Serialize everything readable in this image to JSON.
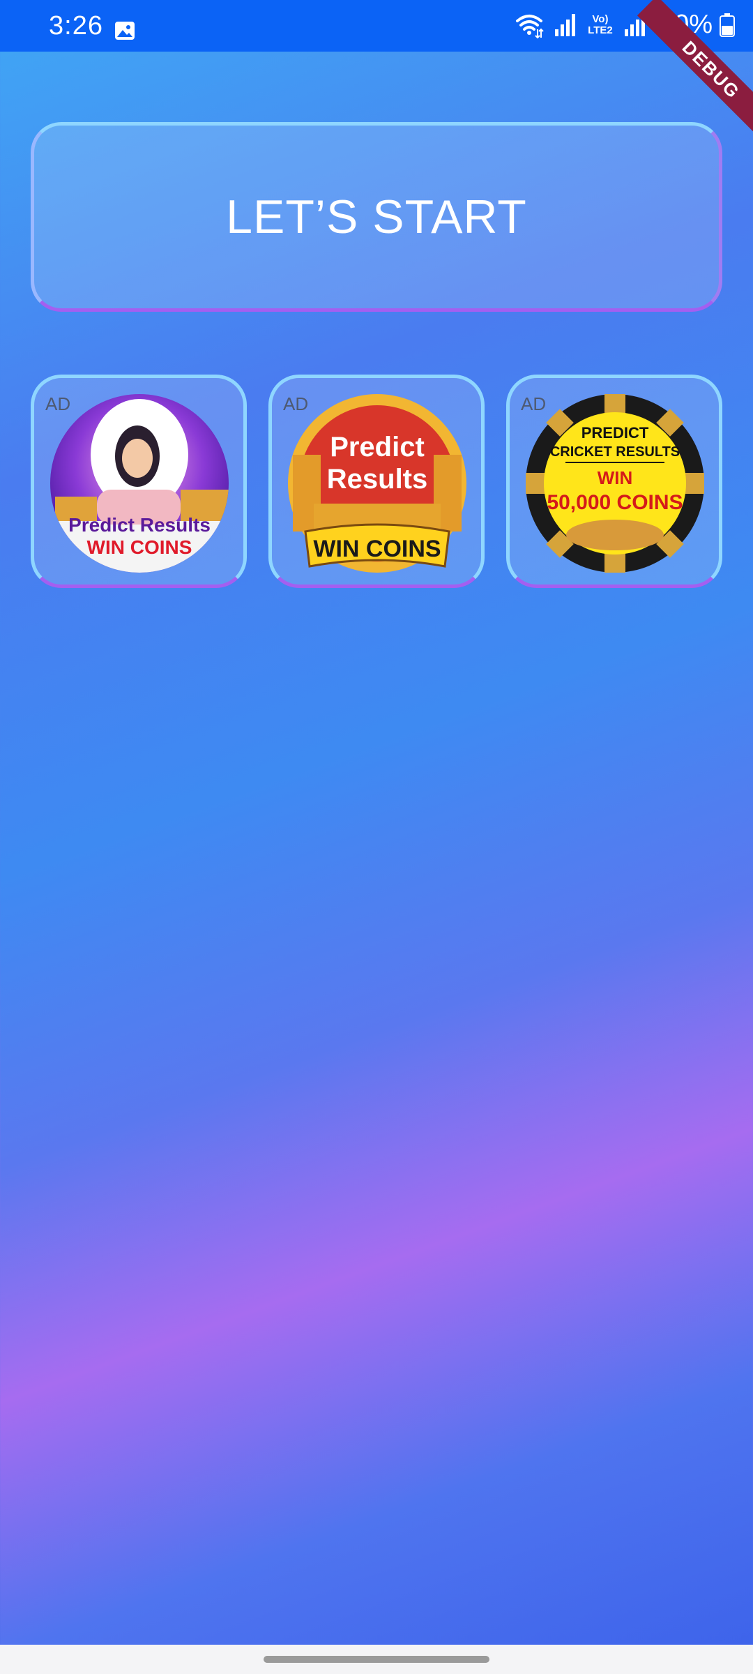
{
  "status_bar": {
    "time": "3:26",
    "network_label_top": "Vo)",
    "network_label_bottom": "LTE2",
    "battery": "50%"
  },
  "debug_banner": "DEBUG",
  "start_button": {
    "label": "LET’S START"
  },
  "ads": [
    {
      "tag": "AD",
      "line1": "Predict Results",
      "line2": "WIN COINS"
    },
    {
      "tag": "AD",
      "line1": "Predict",
      "line2": "Results",
      "line3": "WIN COINS"
    },
    {
      "tag": "AD",
      "line1": "PREDICT",
      "line2": "CRICKET RESULTS",
      "line3": "WIN",
      "line4": "50,000 COINS"
    }
  ],
  "colors": {
    "status_bar": "#0b63f6",
    "card_border_top": "#8fd6ff",
    "card_border_bottom": "#a45ff0",
    "debug_ribbon": "#8b1d3f"
  }
}
